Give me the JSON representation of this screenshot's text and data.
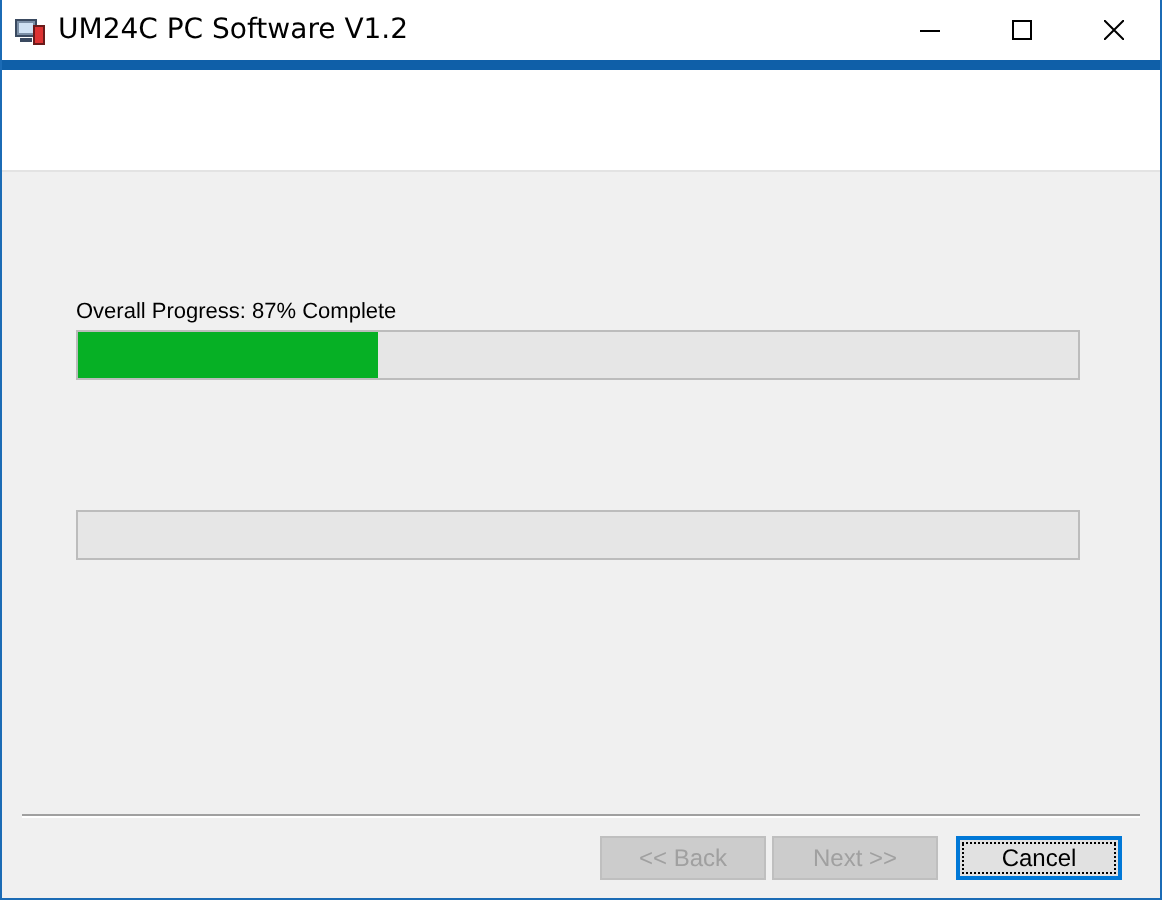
{
  "window": {
    "title": "UM24C PC Software V1.2"
  },
  "progress": [
    {
      "kind": "labeled",
      "label": "Overall Progress: 87% Complete",
      "level": 0.3
    },
    {
      "kind": "plain"
    }
  ],
  "buttons": [
    {
      "label": "<< Back",
      "disabled": true,
      "focused": false
    },
    {
      "label": "Next >>",
      "disabled": true,
      "focused": false
    },
    {
      "label": "Cancel",
      "disabled": false,
      "focused": true
    }
  ]
}
